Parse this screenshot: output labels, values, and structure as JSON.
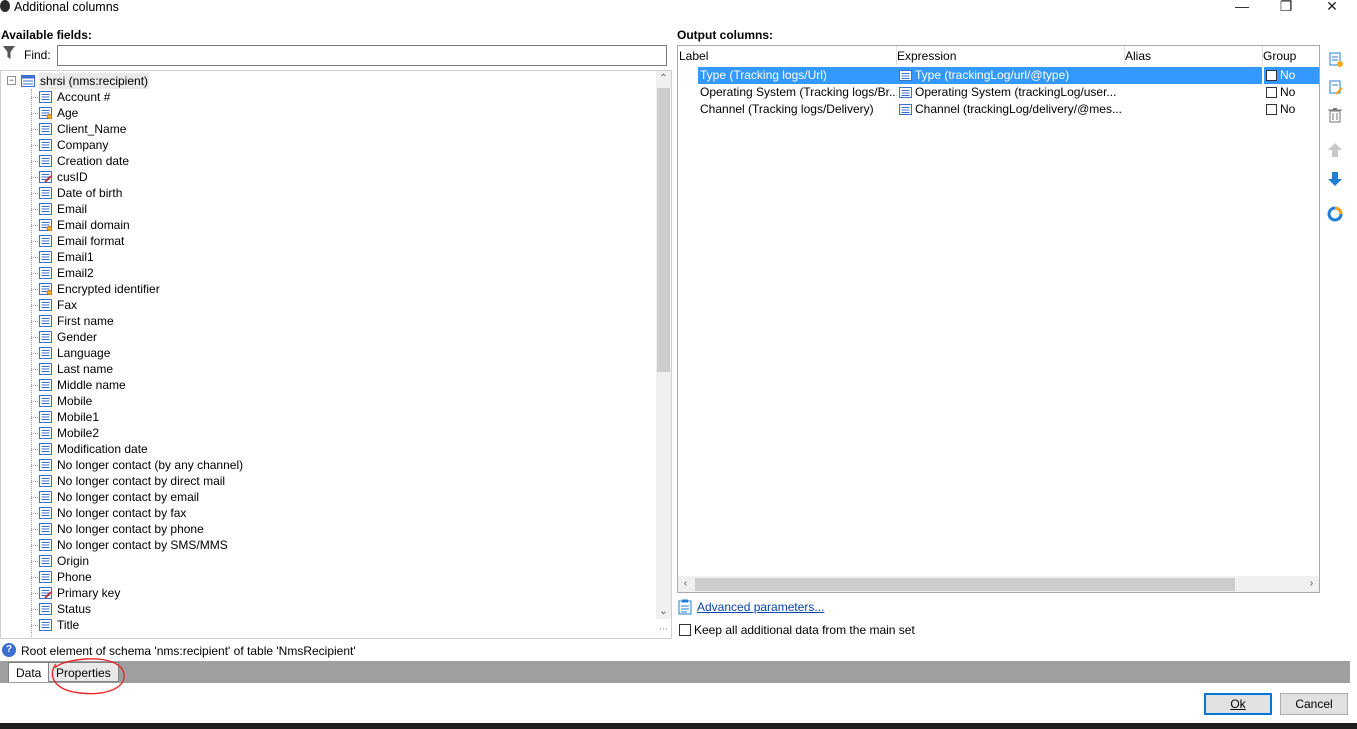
{
  "window": {
    "title": "Additional columns",
    "controls": [
      "—",
      "❐",
      "✕"
    ]
  },
  "left": {
    "section_label": "Available fields:",
    "find_label": "Find:",
    "find_value": "",
    "root": "shrsi (nms:recipient)",
    "items": [
      {
        "label": "Account #",
        "icon": "field-icon"
      },
      {
        "label": "Age",
        "icon": "computed-field-icon"
      },
      {
        "label": "Client_Name",
        "icon": "field-icon"
      },
      {
        "label": "Company",
        "icon": "field-icon"
      },
      {
        "label": "Creation date",
        "icon": "field-icon"
      },
      {
        "label": "cusID",
        "icon": "key-field-icon"
      },
      {
        "label": "Date of birth",
        "icon": "field-icon"
      },
      {
        "label": "Email",
        "icon": "field-icon"
      },
      {
        "label": "Email domain",
        "icon": "computed-field-icon"
      },
      {
        "label": "Email format",
        "icon": "field-icon"
      },
      {
        "label": "Email1",
        "icon": "field-icon"
      },
      {
        "label": "Email2",
        "icon": "field-icon"
      },
      {
        "label": "Encrypted identifier",
        "icon": "computed-field-icon"
      },
      {
        "label": "Fax",
        "icon": "field-icon"
      },
      {
        "label": "First name",
        "icon": "field-icon"
      },
      {
        "label": "Gender",
        "icon": "field-icon"
      },
      {
        "label": "Language",
        "icon": "field-icon"
      },
      {
        "label": "Last name",
        "icon": "field-icon"
      },
      {
        "label": "Middle name",
        "icon": "field-icon"
      },
      {
        "label": "Mobile",
        "icon": "field-icon"
      },
      {
        "label": "Mobile1",
        "icon": "field-icon"
      },
      {
        "label": "Mobile2",
        "icon": "field-icon"
      },
      {
        "label": "Modification date",
        "icon": "field-icon"
      },
      {
        "label": "No longer contact (by any channel)",
        "icon": "field-icon"
      },
      {
        "label": "No longer contact by direct mail",
        "icon": "field-icon"
      },
      {
        "label": "No longer contact by email",
        "icon": "field-icon"
      },
      {
        "label": "No longer contact by fax",
        "icon": "field-icon"
      },
      {
        "label": "No longer contact by phone",
        "icon": "field-icon"
      },
      {
        "label": "No longer contact by SMS/MMS",
        "icon": "field-icon"
      },
      {
        "label": "Origin",
        "icon": "field-icon"
      },
      {
        "label": "Phone",
        "icon": "field-icon"
      },
      {
        "label": "Primary key",
        "icon": "key-field-icon"
      },
      {
        "label": "Status",
        "icon": "field-icon"
      },
      {
        "label": "Title",
        "icon": "field-icon"
      }
    ]
  },
  "status": {
    "text": "Root element of schema 'nms:recipient' of table 'NmsRecipient'"
  },
  "tabs": {
    "data": "Data",
    "properties": "Properties"
  },
  "right": {
    "section_label": "Output columns:",
    "columns": {
      "label": "Label",
      "expression": "Expression",
      "alias": "Alias",
      "group": "Group"
    },
    "rows": [
      {
        "label": "Type (Tracking logs/Url)",
        "expression": "Type (trackingLog/url/@type)",
        "alias": "",
        "group": "No",
        "selected": true
      },
      {
        "label": "Operating System (Tracking logs/Br...",
        "expression": "Operating System (trackingLog/user...",
        "alias": "",
        "group": "No",
        "selected": false
      },
      {
        "label": "Channel (Tracking logs/Delivery)",
        "expression": "Channel (trackingLog/delivery/@mes...",
        "alias": "",
        "group": "No",
        "selected": false
      }
    ],
    "advanced_link": "Advanced parameters...",
    "keep_label": "Keep all additional data from the main set"
  },
  "buttons": {
    "ok": "Ok",
    "cancel": "Cancel"
  },
  "colors": {
    "selection": "#3399ff",
    "link": "#0645ad",
    "accent_tool": "#1f7fd6",
    "annotation": "#e8262b"
  }
}
